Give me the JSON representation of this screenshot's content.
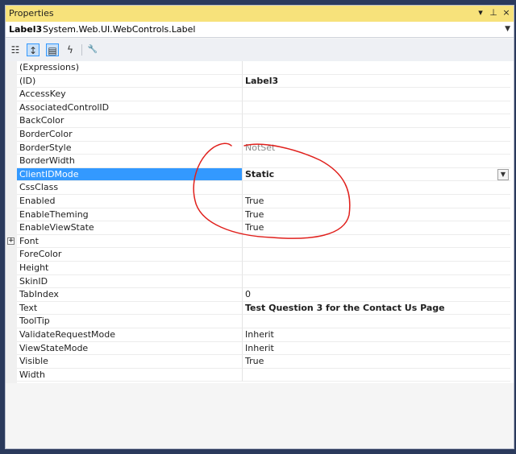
{
  "window": {
    "title": "Properties",
    "buttons": [
      "▾",
      "⊥",
      "×"
    ]
  },
  "object_selector": {
    "name": "Label3",
    "type": "System.Web.UI.WebControls.Label"
  },
  "toolbar": {
    "icons": [
      "categorized-icon",
      "alphabetical-icon",
      "properties-icon",
      "events-icon",
      "property-pages-icon"
    ],
    "glyphs": [
      "☷",
      "↕",
      "▤",
      "ϟ",
      "🔧"
    ],
    "active": [
      false,
      true,
      true,
      false,
      false
    ]
  },
  "properties": [
    {
      "name": "(Expressions)",
      "value": "",
      "style": ""
    },
    {
      "name": "(ID)",
      "value": "Label3",
      "style": "bold"
    },
    {
      "name": "AccessKey",
      "value": "",
      "style": ""
    },
    {
      "name": "AssociatedControlID",
      "value": "",
      "style": ""
    },
    {
      "name": "BackColor",
      "value": "",
      "style": ""
    },
    {
      "name": "BorderColor",
      "value": "",
      "style": ""
    },
    {
      "name": "BorderStyle",
      "value": "NotSet",
      "style": "dim"
    },
    {
      "name": "BorderWidth",
      "value": "",
      "style": ""
    },
    {
      "name": "ClientIDMode",
      "value": "Static",
      "style": "bold",
      "selected": true
    },
    {
      "name": "CssClass",
      "value": "",
      "style": ""
    },
    {
      "name": "Enabled",
      "value": "True",
      "style": ""
    },
    {
      "name": "EnableTheming",
      "value": "True",
      "style": ""
    },
    {
      "name": "EnableViewState",
      "value": "True",
      "style": ""
    },
    {
      "name": "Font",
      "value": "",
      "style": "",
      "expandable": true
    },
    {
      "name": "ForeColor",
      "value": "",
      "style": ""
    },
    {
      "name": "Height",
      "value": "",
      "style": ""
    },
    {
      "name": "SkinID",
      "value": "",
      "style": ""
    },
    {
      "name": "TabIndex",
      "value": "0",
      "style": ""
    },
    {
      "name": "Text",
      "value": "Test Question 3 for the Contact Us Page",
      "style": "bold"
    },
    {
      "name": "ToolTip",
      "value": "",
      "style": ""
    },
    {
      "name": "ValidateRequestMode",
      "value": "Inherit",
      "style": ""
    },
    {
      "name": "ViewStateMode",
      "value": "Inherit",
      "style": ""
    },
    {
      "name": "Visible",
      "value": "True",
      "style": ""
    },
    {
      "name": "Width",
      "value": "",
      "style": ""
    }
  ],
  "colors": {
    "title_bar": "#f7e27b",
    "selection": "#3399ff",
    "annotation": "#e0201c"
  }
}
